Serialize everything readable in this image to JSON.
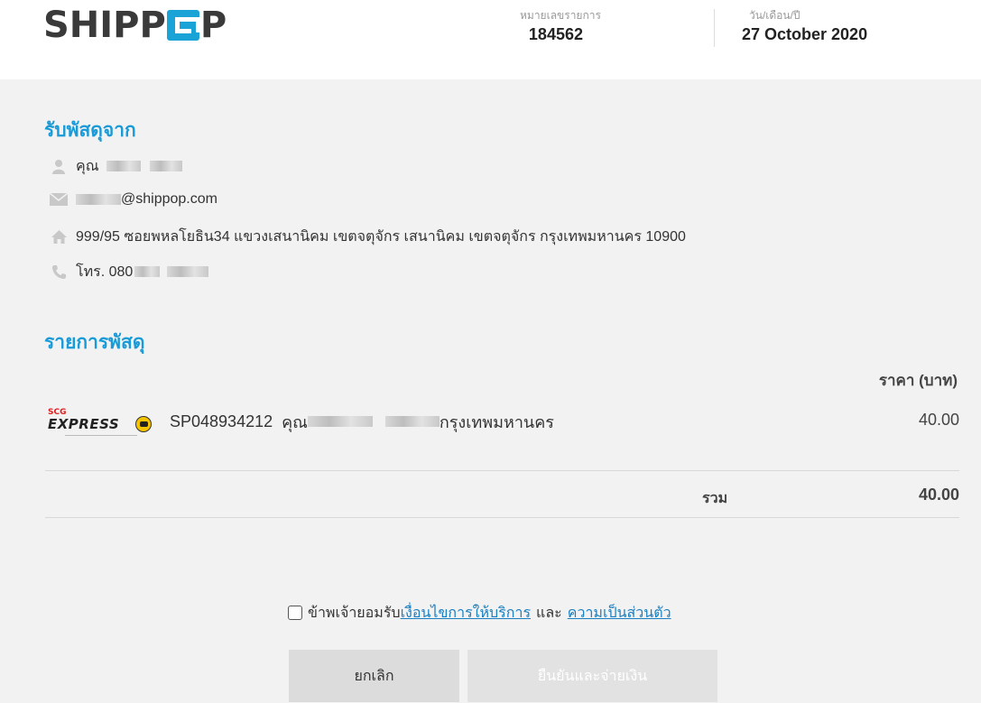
{
  "header": {
    "logo_text": "SHIPPOP",
    "order_label": "หมายเลขรายการ",
    "order_number": "184562",
    "date_label": "วัน/เดือน/ปี",
    "date_value": "27 October 2020",
    "brand_color": "#1aa3d6"
  },
  "sender": {
    "title": "รับพัสดุจาก",
    "name_prefix": "คุณ",
    "email_suffix": "@shippop.com",
    "address": "999/95 ซอยพหลโยธิน34 แขวงเสนานิคม เขตจตุจักร เสนานิคม เขตจตุจักร กรุงเทพมหานคร 10900",
    "phone_prefix": "โทร. 080",
    "icons": [
      "user-icon",
      "envelope-icon",
      "home-icon",
      "phone-icon"
    ]
  },
  "items": {
    "title": "รายการพัสดุ",
    "price_header": "ราคา (บาท)",
    "rows": [
      {
        "carrier": "SCG EXPRESS",
        "carrier_top": "SCG",
        "carrier_main": "EXPRESS",
        "tracking": "SP048934212",
        "recipient_prefix": "คุณ",
        "province": "กรุงเทพมหานคร",
        "price": "40.00"
      }
    ],
    "total_label": "รวม",
    "total_value": "40.00"
  },
  "agreement": {
    "prefix": "ข้าพเจ้ายอมรับ",
    "terms_link": "เงื่อนไขการให้บริการ",
    "and": "และ",
    "privacy_link": "ความเป็นส่วนตัว",
    "checked": false
  },
  "buttons": {
    "cancel": "ยกเลิก",
    "confirm": "ยืนยันและจ่ายเงิน"
  },
  "colors": {
    "accent": "#1a9bd7",
    "link": "#1a7fc1",
    "panel_bg": "#f2f2f2"
  }
}
